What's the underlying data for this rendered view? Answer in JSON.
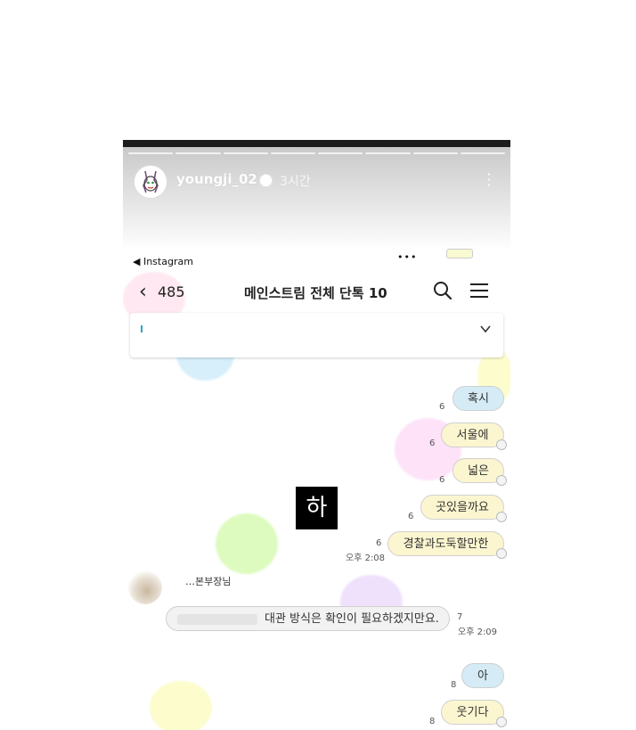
{
  "story": {
    "username": "youngji_02",
    "time_ago": "3시간",
    "progress_segments": 8,
    "more_icon": "more-vertical-icon"
  },
  "status_bar": {
    "back_app": "◀ Instagram",
    "signal": "•••"
  },
  "chat": {
    "back_count": "485",
    "title": "메인스트림 전체 단톡 10",
    "icons": [
      "chevron-left-icon",
      "search-icon",
      "menu-icon",
      "chevron-down-icon"
    ]
  },
  "overlay_label": "하",
  "messages": [
    {
      "text": "혹시",
      "count": "6",
      "color": "blue"
    },
    {
      "text": "서울에",
      "count": "6",
      "color": "yellow"
    },
    {
      "text": "넓은",
      "count": "6",
      "color": "yellow"
    },
    {
      "text": "곳있을까요",
      "count": "6",
      "color": "yellow"
    },
    {
      "text": "경찰과도둑할만한",
      "count": "6",
      "color": "yellow",
      "time": "오후 2:08"
    },
    {
      "sender": "…본부장님",
      "text": "대관 방식은 확인이 필요하겠지만요.",
      "count": "7",
      "time": "오후 2:09"
    },
    {
      "text": "아",
      "count": "8",
      "color": "blue"
    },
    {
      "text": "웃기다",
      "count": "8",
      "color": "yellow"
    }
  ],
  "colors": {
    "bubble_blue": "#d5ecf6",
    "bubble_yellow": "#fbf6d0",
    "bubble_gray": "#f2f2f2"
  }
}
